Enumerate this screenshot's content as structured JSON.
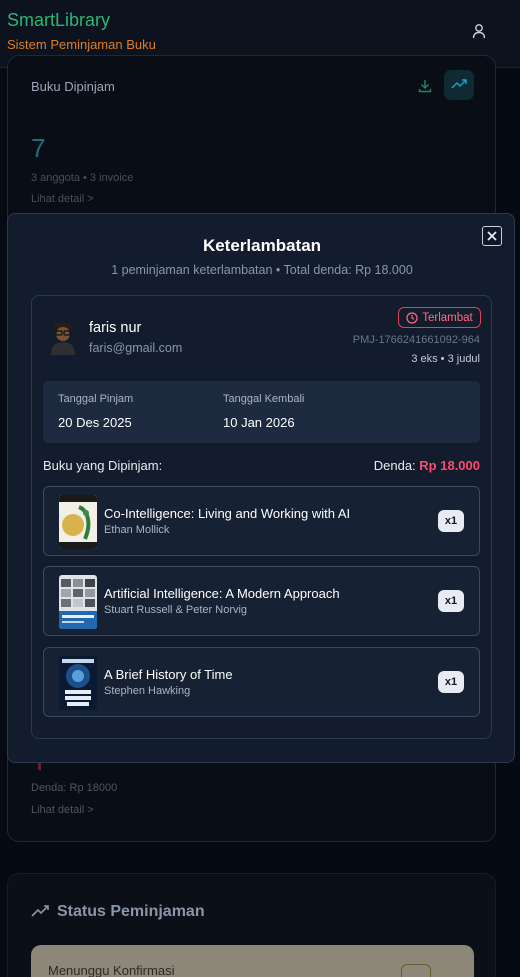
{
  "header": {
    "app_title": "SmartLibrary",
    "app_subtitle": "Sistem Peminjaman Buku"
  },
  "background_card": {
    "label": "Buku Dipinjam",
    "value": "7",
    "meta": "3 anggota • 3 invoice",
    "link": "Lihat detail >",
    "denda_text": "Denda: Rp 18000",
    "link2": "Lihat detail >"
  },
  "status_section": {
    "title": "Status Peminjaman",
    "first_item": "Menunggu Konfirmasi"
  },
  "modal": {
    "title": "Keterlambatan",
    "subtitle": "1 peminjaman keterlambatan • Total denda: Rp 18.000",
    "loan": {
      "borrower_name": "faris nur",
      "borrower_email": "faris@gmail.com",
      "status_badge": "Terlambat",
      "loan_id": "PMJ-1766241661092-964",
      "count_text": "3 eks • 3 judul",
      "borrow_date_label": "Tanggal Pinjam",
      "borrow_date": "20 Des 2025",
      "return_date_label": "Tanggal Kembali",
      "return_date": "10 Jan 2026",
      "books_heading": "Buku yang Dipinjam:",
      "fine_label": "Denda: ",
      "fine_amount": "Rp 18.000",
      "books": [
        {
          "title": "Co-Intelligence: Living and Working with AI",
          "author": "Ethan Mollick",
          "qty": "x1"
        },
        {
          "title": "Artificial Intelligence: A Modern Approach",
          "author": "Stuart Russell & Peter Norvig",
          "qty": "x1"
        },
        {
          "title": "A Brief History of Time",
          "author": "Stephen Hawking",
          "qty": "x1"
        }
      ]
    }
  },
  "colors": {
    "brand_green": "#2bb673",
    "brand_orange": "#e07b24",
    "late_red": "#ff4a6e",
    "modal_bg": "#121c2c"
  }
}
